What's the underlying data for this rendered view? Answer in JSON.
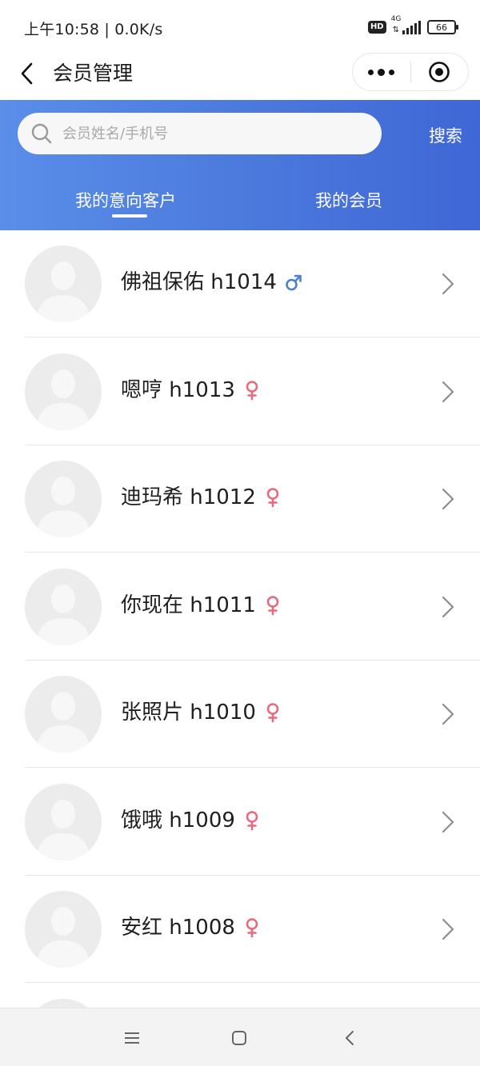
{
  "status_bar": {
    "time": "上午10:58 | 0.0K/s",
    "hd": "HD",
    "network": "4G",
    "battery": "66"
  },
  "nav": {
    "title": "会员管理"
  },
  "search": {
    "placeholder": "会员姓名/手机号",
    "button_label": "搜索"
  },
  "tabs": [
    {
      "label": "我的意向客户",
      "active": true
    },
    {
      "label": "我的会员",
      "active": false
    }
  ],
  "members": [
    {
      "name": "佛祖保佑 h1014",
      "gender": "male"
    },
    {
      "name": "嗯哼 h1013",
      "gender": "female"
    },
    {
      "name": "迪玛希 h1012",
      "gender": "female"
    },
    {
      "name": "你现在 h1011",
      "gender": "female"
    },
    {
      "name": "张照片 h1010",
      "gender": "female"
    },
    {
      "name": "饿哦 h1009",
      "gender": "female"
    },
    {
      "name": "安红 h1008",
      "gender": "female"
    }
  ],
  "colors": {
    "header_gradient_start": "#5a8ee9",
    "header_gradient_end": "#3f67d6",
    "male_icon": "#4a7fd6",
    "female_icon": "#e86a7e"
  },
  "icons": {
    "back": "chevron-left-icon",
    "more": "more-dots-icon",
    "close": "target-close-icon",
    "search": "search-icon",
    "row_arrow": "chevron-right-icon",
    "male": "male-icon",
    "female": "female-icon"
  }
}
